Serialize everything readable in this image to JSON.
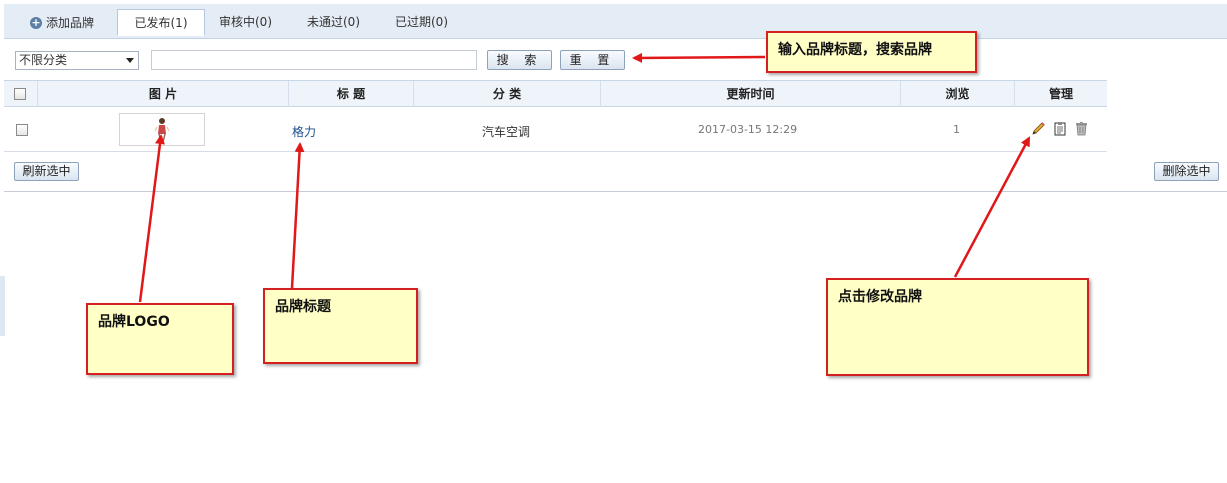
{
  "tabs": {
    "add_label": "添加品牌",
    "published": "已发布(1)",
    "reviewing": "审核中(0)",
    "rejected": "未通过(0)",
    "expired": "已过期(0)"
  },
  "filter": {
    "category_selected": "不限分类",
    "search_value": "",
    "search_button": "搜 索",
    "reset_button": "重 置"
  },
  "table": {
    "headers": {
      "image": "图 片",
      "title": "标 题",
      "category": "分 类",
      "updated": "更新时间",
      "views": "浏览",
      "manage": "管理"
    },
    "rows": [
      {
        "title": "格力",
        "category": "汽车空调",
        "updated": "2017-03-15 12:29",
        "views": "1"
      }
    ]
  },
  "actions": {
    "refresh_selected": "刷新选中",
    "delete_selected": "删除选中"
  },
  "annotations": {
    "search_note": "输入品牌标题，搜索品牌",
    "logo_note": "品牌LOGO",
    "title_note": "品牌标题",
    "edit_note": "点击修改品牌"
  },
  "colors": {
    "annotation_border": "#d42020",
    "annotation_fill": "#ffffc6",
    "link": "#1d4f8c"
  },
  "icons": [
    "plus-circle-icon",
    "dropdown-arrow-icon",
    "pencil-icon",
    "copy-icon",
    "trash-icon"
  ]
}
